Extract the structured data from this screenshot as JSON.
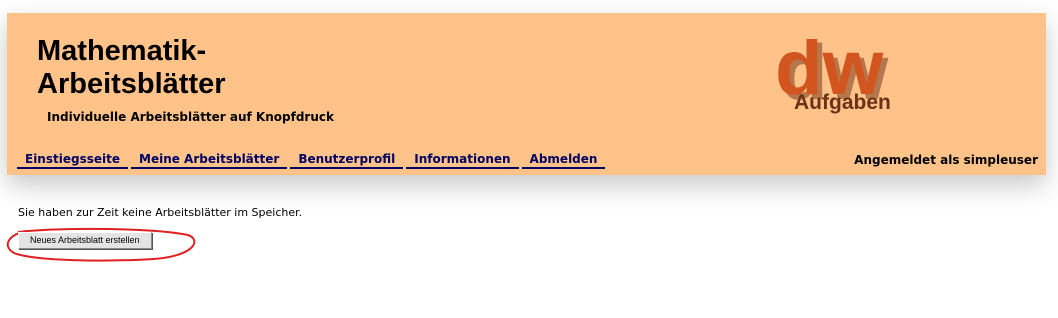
{
  "header": {
    "title_line1": "Mathematik-",
    "title_line2": "Arbeitsblätter",
    "subtitle": "Individuelle Arbeitsblätter auf Knopfdruck",
    "logo": {
      "big_text": "dw",
      "small_text": "Aufgaben"
    },
    "background": "#ffc38a"
  },
  "nav": {
    "items": [
      {
        "label": "Einstiegsseite"
      },
      {
        "label": "Meine Arbeitsblätter"
      },
      {
        "label": "Benutzerprofil"
      },
      {
        "label": "Informationen"
      },
      {
        "label": "Abmelden"
      }
    ],
    "link_color": "#000062",
    "user_status": "Angemeldet als simpleuser"
  },
  "main": {
    "message": "Sie haben zur Zeit keine Arbeitsblätter im Speicher.",
    "create_button_label": "Neues Arbeitsblatt erstellen",
    "highlight_color": "#e02020"
  }
}
